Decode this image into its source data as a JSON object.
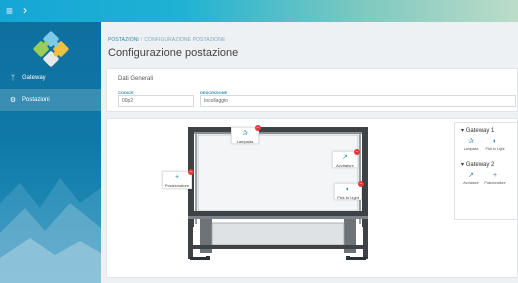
{
  "topbar": {
    "menu_icon": "hamburger-icon",
    "back_icon": "arrow-right-icon",
    "colors": {
      "start": "#16a6d6",
      "end": "#bcdcc8"
    }
  },
  "sidebar": {
    "logo": "puzzle-logo",
    "items": [
      {
        "icon": "git-branch-icon",
        "label": "Gateway"
      },
      {
        "icon": "cogs-icon",
        "label": "Postazioni"
      }
    ],
    "colors": {
      "background": "#0f79a6",
      "active": "#2f8fba"
    }
  },
  "breadcrumb": {
    "items": [
      "POSTAZIONI",
      "CONFIGURAZIONE POSTAZIONE"
    ]
  },
  "page": {
    "title": "Configurazione postazione"
  },
  "general": {
    "heading": "Dati Generali",
    "codice_label": "CODICE",
    "codice_value": "00p2",
    "descrizione_label": "DESCRIZIONE",
    "descrizione_value": "Incollaggio"
  },
  "canvas": {
    "nodes": [
      {
        "icon": "lamp-icon",
        "label": "Lampada"
      },
      {
        "icon": "screwdriver-icon",
        "label": "Avvitatore"
      },
      {
        "icon": "pick-to-light-icon",
        "label": "Pick to Light"
      },
      {
        "icon": "crosshair-icon",
        "label": "Posizionatore"
      }
    ],
    "delete_icon": "remove-icon"
  },
  "gateways": [
    {
      "name": "Gateway 1",
      "devices": [
        {
          "icon": "lamp-icon",
          "label": "Lampada"
        },
        {
          "icon": "pick-to-light-icon",
          "label": "Pick to Light"
        }
      ]
    },
    {
      "name": "Gateway 2",
      "devices": [
        {
          "icon": "screwdriver-icon",
          "label": "Avvitatore"
        },
        {
          "icon": "crosshair-icon",
          "label": "Posizionatore"
        }
      ]
    }
  ]
}
